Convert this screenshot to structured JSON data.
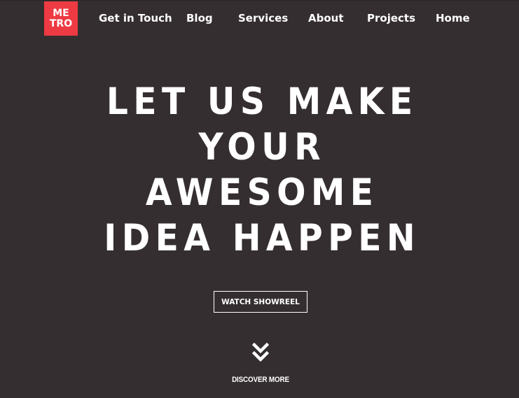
{
  "brand": {
    "logo_line1": "ME",
    "logo_line2": "TRO",
    "accent_color": "#ee3a43",
    "background_color": "#352e30"
  },
  "nav": {
    "items": [
      {
        "label": "Get in Touch"
      },
      {
        "label": "Blog"
      },
      {
        "label": "Services"
      },
      {
        "label": "About"
      },
      {
        "label": "Projects"
      },
      {
        "label": "Home"
      }
    ]
  },
  "hero": {
    "lines": [
      "LET US MAKE",
      "YOUR",
      "AWESOME",
      "IDEA HAPPEN"
    ],
    "cta_label": "WATCH SHOWREEL"
  },
  "discover": {
    "label": "DISCOVER MORE",
    "icon": "double-chevron-down-icon"
  }
}
